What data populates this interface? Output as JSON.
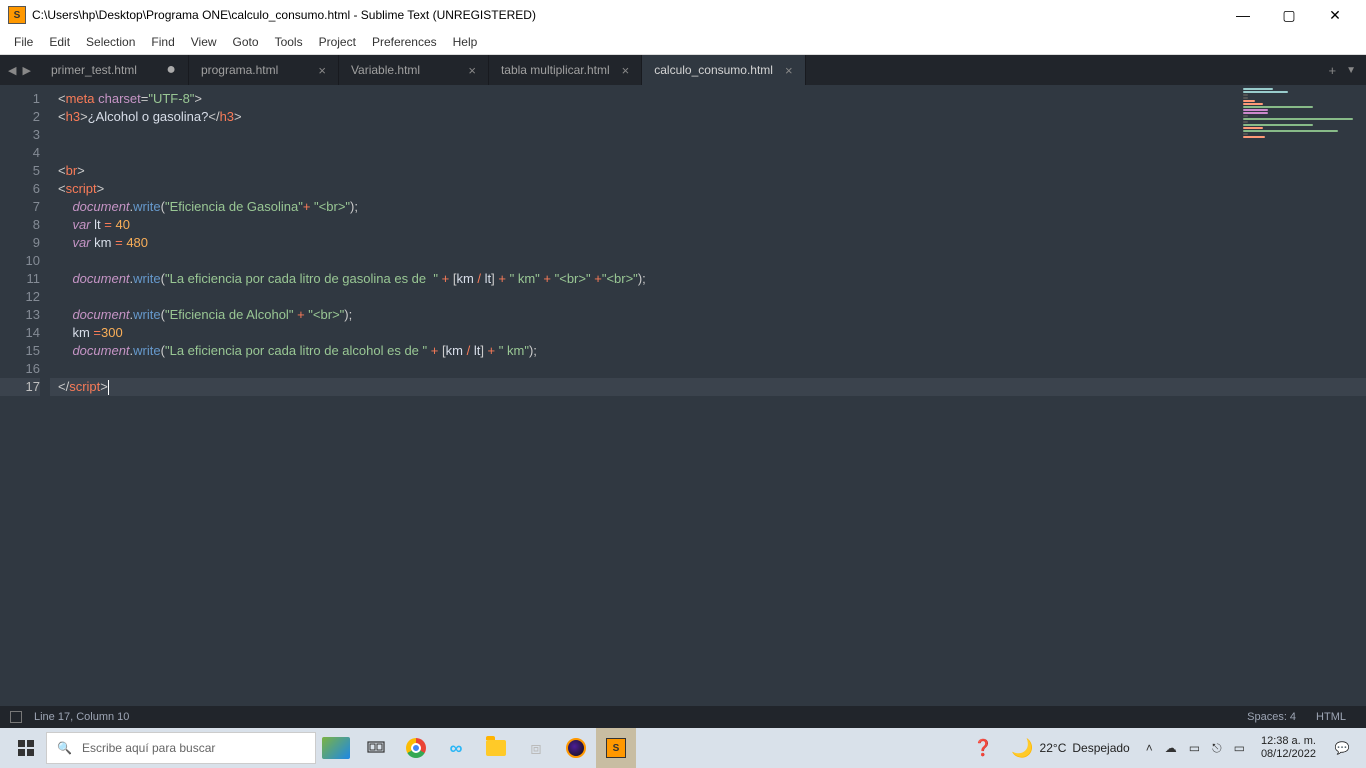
{
  "titlebar": {
    "app_icon_text": "S",
    "title": "C:\\Users\\hp\\Desktop\\Programa ONE\\calculo_consumo.html - Sublime Text (UNREGISTERED)"
  },
  "menu": [
    "File",
    "Edit",
    "Selection",
    "Find",
    "View",
    "Goto",
    "Tools",
    "Project",
    "Preferences",
    "Help"
  ],
  "tabs": [
    {
      "label": "primer_test.html",
      "dirty": true,
      "active": false
    },
    {
      "label": "programa.html",
      "dirty": false,
      "active": false
    },
    {
      "label": "Variable.html",
      "dirty": false,
      "active": false
    },
    {
      "label": "tabla multiplicar.html",
      "dirty": false,
      "active": false
    },
    {
      "label": "calculo_consumo.html",
      "dirty": false,
      "active": true
    }
  ],
  "editor": {
    "line_count": 17,
    "current_line": 17,
    "code_tokens": [
      [
        {
          "c": "p",
          "t": "<"
        },
        {
          "c": "tg",
          "t": "meta"
        },
        {
          "c": "p",
          "t": " "
        },
        {
          "c": "at",
          "t": "charset"
        },
        {
          "c": "p",
          "t": "="
        },
        {
          "c": "st",
          "t": "\"UTF-8\""
        },
        {
          "c": "p",
          "t": ">"
        }
      ],
      [
        {
          "c": "p",
          "t": "<"
        },
        {
          "c": "tg",
          "t": "h3"
        },
        {
          "c": "p",
          "t": ">"
        },
        {
          "c": "tx",
          "t": "¿Alcohol o gasolina?"
        },
        {
          "c": "p",
          "t": "</"
        },
        {
          "c": "tg",
          "t": "h3"
        },
        {
          "c": "p",
          "t": ">"
        }
      ],
      [],
      [],
      [
        {
          "c": "p",
          "t": "<"
        },
        {
          "c": "tg",
          "t": "br"
        },
        {
          "c": "p",
          "t": ">"
        }
      ],
      [
        {
          "c": "p",
          "t": "<"
        },
        {
          "c": "tg",
          "t": "script"
        },
        {
          "c": "p",
          "t": ">"
        }
      ],
      [
        {
          "c": "p",
          "t": "    "
        },
        {
          "c": "kw",
          "t": "document"
        },
        {
          "c": "p",
          "t": "."
        },
        {
          "c": "fn",
          "t": "write"
        },
        {
          "c": "p",
          "t": "("
        },
        {
          "c": "st",
          "t": "\"Eficiencia de Gasolina\""
        },
        {
          "c": "op",
          "t": "+"
        },
        {
          "c": "p",
          "t": " "
        },
        {
          "c": "st",
          "t": "\"<br>\""
        },
        {
          "c": "p",
          "t": ");"
        }
      ],
      [
        {
          "c": "p",
          "t": "    "
        },
        {
          "c": "kw",
          "t": "var"
        },
        {
          "c": "p",
          "t": " "
        },
        {
          "c": "id",
          "t": "lt"
        },
        {
          "c": "p",
          "t": " "
        },
        {
          "c": "op",
          "t": "="
        },
        {
          "c": "p",
          "t": " "
        },
        {
          "c": "nm",
          "t": "40"
        }
      ],
      [
        {
          "c": "p",
          "t": "    "
        },
        {
          "c": "kw",
          "t": "var"
        },
        {
          "c": "p",
          "t": " "
        },
        {
          "c": "id",
          "t": "km"
        },
        {
          "c": "p",
          "t": " "
        },
        {
          "c": "op",
          "t": "="
        },
        {
          "c": "p",
          "t": " "
        },
        {
          "c": "nm",
          "t": "480"
        }
      ],
      [],
      [
        {
          "c": "p",
          "t": "    "
        },
        {
          "c": "kw",
          "t": "document"
        },
        {
          "c": "p",
          "t": "."
        },
        {
          "c": "fn",
          "t": "write"
        },
        {
          "c": "p",
          "t": "("
        },
        {
          "c": "st",
          "t": "\"La eficiencia por cada litro de gasolina es de  \""
        },
        {
          "c": "p",
          "t": " "
        },
        {
          "c": "op",
          "t": "+"
        },
        {
          "c": "p",
          "t": " ["
        },
        {
          "c": "id",
          "t": "km"
        },
        {
          "c": "p",
          "t": " "
        },
        {
          "c": "op",
          "t": "/"
        },
        {
          "c": "p",
          "t": " "
        },
        {
          "c": "id",
          "t": "lt"
        },
        {
          "c": "p",
          "t": "] "
        },
        {
          "c": "op",
          "t": "+"
        },
        {
          "c": "p",
          "t": " "
        },
        {
          "c": "st",
          "t": "\" km\""
        },
        {
          "c": "p",
          "t": " "
        },
        {
          "c": "op",
          "t": "+"
        },
        {
          "c": "p",
          "t": " "
        },
        {
          "c": "st",
          "t": "\"<br>\""
        },
        {
          "c": "p",
          "t": " "
        },
        {
          "c": "op",
          "t": "+"
        },
        {
          "c": "st",
          "t": "\"<br>\""
        },
        {
          "c": "p",
          "t": ");"
        }
      ],
      [],
      [
        {
          "c": "p",
          "t": "    "
        },
        {
          "c": "kw",
          "t": "document"
        },
        {
          "c": "p",
          "t": "."
        },
        {
          "c": "fn",
          "t": "write"
        },
        {
          "c": "p",
          "t": "("
        },
        {
          "c": "st",
          "t": "\"Eficiencia de Alcohol\""
        },
        {
          "c": "p",
          "t": " "
        },
        {
          "c": "op",
          "t": "+"
        },
        {
          "c": "p",
          "t": " "
        },
        {
          "c": "st",
          "t": "\"<br>\""
        },
        {
          "c": "p",
          "t": ");"
        }
      ],
      [
        {
          "c": "p",
          "t": "    "
        },
        {
          "c": "id",
          "t": "km"
        },
        {
          "c": "p",
          "t": " "
        },
        {
          "c": "op",
          "t": "="
        },
        {
          "c": "nm",
          "t": "300"
        }
      ],
      [
        {
          "c": "p",
          "t": "    "
        },
        {
          "c": "kw",
          "t": "document"
        },
        {
          "c": "p",
          "t": "."
        },
        {
          "c": "fn",
          "t": "write"
        },
        {
          "c": "p",
          "t": "("
        },
        {
          "c": "st",
          "t": "\"La eficiencia por cada litro de alcohol es de \""
        },
        {
          "c": "p",
          "t": " "
        },
        {
          "c": "op",
          "t": "+"
        },
        {
          "c": "p",
          "t": " ["
        },
        {
          "c": "id",
          "t": "km"
        },
        {
          "c": "p",
          "t": " "
        },
        {
          "c": "op",
          "t": "/"
        },
        {
          "c": "p",
          "t": " "
        },
        {
          "c": "id",
          "t": "lt"
        },
        {
          "c": "p",
          "t": "] "
        },
        {
          "c": "op",
          "t": "+"
        },
        {
          "c": "p",
          "t": " "
        },
        {
          "c": "st",
          "t": "\" km\""
        },
        {
          "c": "p",
          "t": ");"
        }
      ],
      [],
      [
        {
          "c": "p",
          "t": "</"
        },
        {
          "c": "tg",
          "t": "script"
        },
        {
          "c": "p",
          "t": ">"
        }
      ]
    ]
  },
  "statusbar": {
    "cursor_pos": "Line 17, Column 10",
    "spaces": "Spaces: 4",
    "syntax": "HTML"
  },
  "taskbar": {
    "search_placeholder": "Escribe aquí para buscar",
    "weather_temp": "22°C",
    "weather_desc": "Despejado",
    "time": "12:38 a. m.",
    "date": "08/12/2022"
  }
}
